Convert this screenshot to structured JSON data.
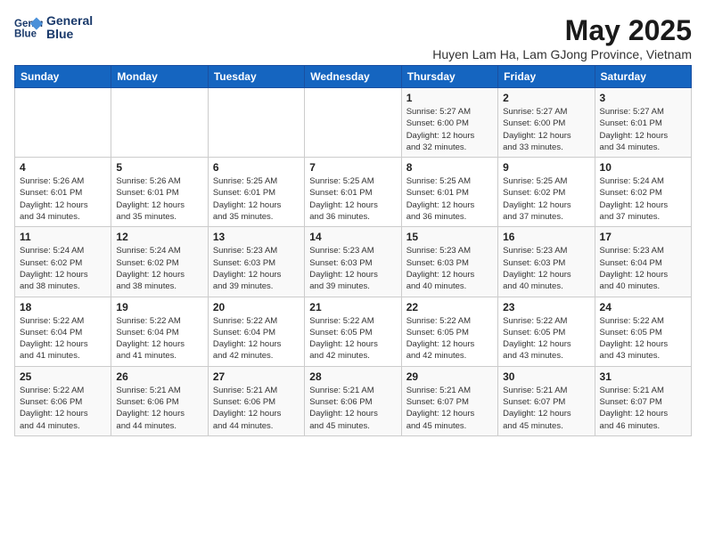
{
  "logo": {
    "line1": "General",
    "line2": "Blue"
  },
  "title": "May 2025",
  "subtitle": "Huyen Lam Ha, Lam GJong Province, Vietnam",
  "days_of_week": [
    "Sunday",
    "Monday",
    "Tuesday",
    "Wednesday",
    "Thursday",
    "Friday",
    "Saturday"
  ],
  "weeks": [
    [
      {
        "day": "",
        "info": ""
      },
      {
        "day": "",
        "info": ""
      },
      {
        "day": "",
        "info": ""
      },
      {
        "day": "",
        "info": ""
      },
      {
        "day": "1",
        "info": "Sunrise: 5:27 AM\nSunset: 6:00 PM\nDaylight: 12 hours\nand 32 minutes."
      },
      {
        "day": "2",
        "info": "Sunrise: 5:27 AM\nSunset: 6:00 PM\nDaylight: 12 hours\nand 33 minutes."
      },
      {
        "day": "3",
        "info": "Sunrise: 5:27 AM\nSunset: 6:01 PM\nDaylight: 12 hours\nand 34 minutes."
      }
    ],
    [
      {
        "day": "4",
        "info": "Sunrise: 5:26 AM\nSunset: 6:01 PM\nDaylight: 12 hours\nand 34 minutes."
      },
      {
        "day": "5",
        "info": "Sunrise: 5:26 AM\nSunset: 6:01 PM\nDaylight: 12 hours\nand 35 minutes."
      },
      {
        "day": "6",
        "info": "Sunrise: 5:25 AM\nSunset: 6:01 PM\nDaylight: 12 hours\nand 35 minutes."
      },
      {
        "day": "7",
        "info": "Sunrise: 5:25 AM\nSunset: 6:01 PM\nDaylight: 12 hours\nand 36 minutes."
      },
      {
        "day": "8",
        "info": "Sunrise: 5:25 AM\nSunset: 6:01 PM\nDaylight: 12 hours\nand 36 minutes."
      },
      {
        "day": "9",
        "info": "Sunrise: 5:25 AM\nSunset: 6:02 PM\nDaylight: 12 hours\nand 37 minutes."
      },
      {
        "day": "10",
        "info": "Sunrise: 5:24 AM\nSunset: 6:02 PM\nDaylight: 12 hours\nand 37 minutes."
      }
    ],
    [
      {
        "day": "11",
        "info": "Sunrise: 5:24 AM\nSunset: 6:02 PM\nDaylight: 12 hours\nand 38 minutes."
      },
      {
        "day": "12",
        "info": "Sunrise: 5:24 AM\nSunset: 6:02 PM\nDaylight: 12 hours\nand 38 minutes."
      },
      {
        "day": "13",
        "info": "Sunrise: 5:23 AM\nSunset: 6:03 PM\nDaylight: 12 hours\nand 39 minutes."
      },
      {
        "day": "14",
        "info": "Sunrise: 5:23 AM\nSunset: 6:03 PM\nDaylight: 12 hours\nand 39 minutes."
      },
      {
        "day": "15",
        "info": "Sunrise: 5:23 AM\nSunset: 6:03 PM\nDaylight: 12 hours\nand 40 minutes."
      },
      {
        "day": "16",
        "info": "Sunrise: 5:23 AM\nSunset: 6:03 PM\nDaylight: 12 hours\nand 40 minutes."
      },
      {
        "day": "17",
        "info": "Sunrise: 5:23 AM\nSunset: 6:04 PM\nDaylight: 12 hours\nand 40 minutes."
      }
    ],
    [
      {
        "day": "18",
        "info": "Sunrise: 5:22 AM\nSunset: 6:04 PM\nDaylight: 12 hours\nand 41 minutes."
      },
      {
        "day": "19",
        "info": "Sunrise: 5:22 AM\nSunset: 6:04 PM\nDaylight: 12 hours\nand 41 minutes."
      },
      {
        "day": "20",
        "info": "Sunrise: 5:22 AM\nSunset: 6:04 PM\nDaylight: 12 hours\nand 42 minutes."
      },
      {
        "day": "21",
        "info": "Sunrise: 5:22 AM\nSunset: 6:05 PM\nDaylight: 12 hours\nand 42 minutes."
      },
      {
        "day": "22",
        "info": "Sunrise: 5:22 AM\nSunset: 6:05 PM\nDaylight: 12 hours\nand 42 minutes."
      },
      {
        "day": "23",
        "info": "Sunrise: 5:22 AM\nSunset: 6:05 PM\nDaylight: 12 hours\nand 43 minutes."
      },
      {
        "day": "24",
        "info": "Sunrise: 5:22 AM\nSunset: 6:05 PM\nDaylight: 12 hours\nand 43 minutes."
      }
    ],
    [
      {
        "day": "25",
        "info": "Sunrise: 5:22 AM\nSunset: 6:06 PM\nDaylight: 12 hours\nand 44 minutes."
      },
      {
        "day": "26",
        "info": "Sunrise: 5:21 AM\nSunset: 6:06 PM\nDaylight: 12 hours\nand 44 minutes."
      },
      {
        "day": "27",
        "info": "Sunrise: 5:21 AM\nSunset: 6:06 PM\nDaylight: 12 hours\nand 44 minutes."
      },
      {
        "day": "28",
        "info": "Sunrise: 5:21 AM\nSunset: 6:06 PM\nDaylight: 12 hours\nand 45 minutes."
      },
      {
        "day": "29",
        "info": "Sunrise: 5:21 AM\nSunset: 6:07 PM\nDaylight: 12 hours\nand 45 minutes."
      },
      {
        "day": "30",
        "info": "Sunrise: 5:21 AM\nSunset: 6:07 PM\nDaylight: 12 hours\nand 45 minutes."
      },
      {
        "day": "31",
        "info": "Sunrise: 5:21 AM\nSunset: 6:07 PM\nDaylight: 12 hours\nand 46 minutes."
      }
    ]
  ]
}
